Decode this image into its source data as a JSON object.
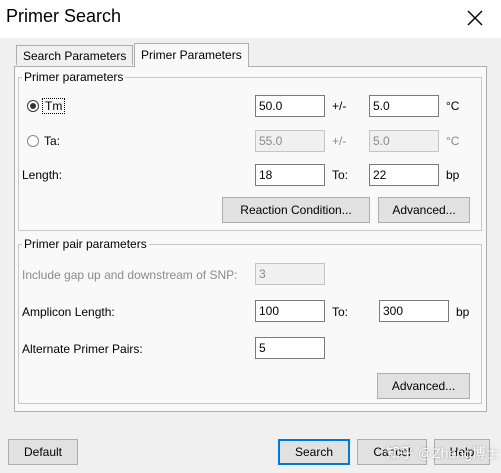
{
  "window": {
    "title": "Primer Search"
  },
  "tabs": [
    {
      "label": "Search Parameters"
    },
    {
      "label": "Primer Parameters"
    }
  ],
  "primer_parameters": {
    "group_label": "Primer parameters",
    "tm": {
      "label": "Tm",
      "value": "50.0",
      "pm": "+/-",
      "tolerance": "5.0",
      "unit": "°C",
      "selected": true
    },
    "ta": {
      "label": "Ta:",
      "value": "55.0",
      "pm": "+/-",
      "tolerance": "5.0",
      "unit": "°C",
      "selected": false
    },
    "length": {
      "label": "Length:",
      "from": "18",
      "to_label": "To:",
      "to": "22",
      "unit": "bp"
    },
    "reaction_button": "Reaction Condition...",
    "advanced_button": "Advanced..."
  },
  "pair_parameters": {
    "group_label": "Primer pair parameters",
    "gap": {
      "label": "Include gap up and downstream of SNP:",
      "value": "3"
    },
    "amplicon": {
      "label": "Amplicon Length:",
      "from": "100",
      "to_label": "To:",
      "to": "300",
      "unit": "bp"
    },
    "alternate": {
      "label": "Alternate Primer Pairs:",
      "value": "5"
    },
    "advanced_button": "Advanced..."
  },
  "footer": {
    "default_button": "Default",
    "search_button": "Search",
    "cancel_button": "Cancel",
    "help_button": "Help"
  },
  "watermark": "知乎 @Zheng博士"
}
